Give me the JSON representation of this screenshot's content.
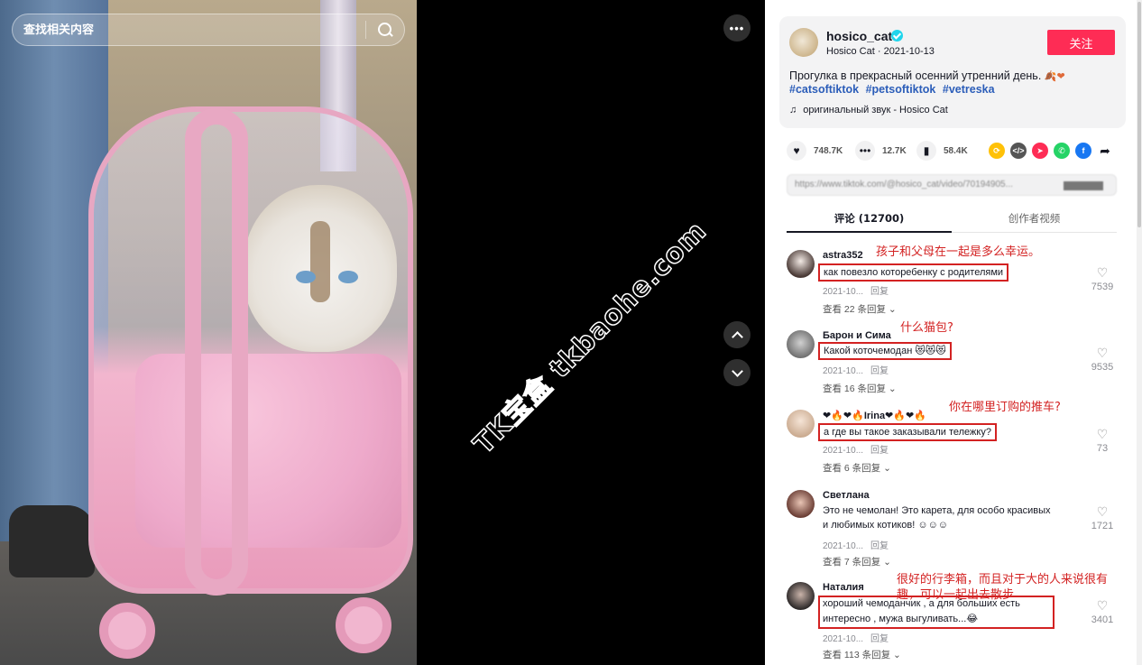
{
  "search": {
    "placeholder": "查找相关内容"
  },
  "video": {
    "more_label": "•••",
    "up_label": "",
    "down_label": "",
    "watermark": "TK宝盒 tkbaohe.com"
  },
  "post": {
    "username": "hosico_cat",
    "sub_line": "Hosico Cat · 2021-10-13",
    "follow_label": "关注",
    "caption": "Прогулка в прекрасный осенний утренний день.",
    "caption_emoji": "🍂❤",
    "hashtags": [
      "#catsoftiktok",
      "#petsoftiktok",
      "#vetreska"
    ],
    "music": "оригинальный звук - Hosico Cat"
  },
  "actions": {
    "likes": "748.7K",
    "comments": "12.7K",
    "saves": "58.4K"
  },
  "link": {
    "text": "https://www.tiktok.com/@hosico_cat/video/70194905..."
  },
  "tabs": {
    "comments": "评论 (12700)",
    "creator_videos": "创作者视频"
  },
  "comments": [
    {
      "name": "astra352",
      "text": "как повезло которебенку с родителями",
      "date": "2021-10...",
      "reply": "回复",
      "replies": "查看 22 条回复",
      "likes": "7539",
      "annotation": "孩子和父母在一起是多么幸运。",
      "avatar_color": "#3a3a3a"
    },
    {
      "name": "Барон и Сима",
      "text": "Какой коточемодан 😻😻😻",
      "date": "2021-10...",
      "reply": "回复",
      "replies": "查看 16 条回复",
      "likes": "9535",
      "annotation": "什么猫包?",
      "avatar_color": "#8c8c8c"
    },
    {
      "name": "❤🔥❤🔥Irina❤🔥❤🔥",
      "text": "а где вы такое заказывали тележку?",
      "date": "2021-10...",
      "reply": "回复",
      "replies": "查看 6 条回复",
      "likes": "73",
      "annotation": "你在哪里订购的推车?",
      "avatar_color": "#d9c3b0"
    },
    {
      "name": "Светлана",
      "text_line1": "Это не чемолан! Это карета, для особо красивых",
      "text_line2": "и любимых котиков! ☺☺☺",
      "date": "2021-10...",
      "reply": "回复",
      "replies": "查看 7 条回复",
      "likes": "1721",
      "avatar_color": "#6b3e35"
    },
    {
      "name": "Наталия",
      "text_line1": "хороший чемоданчик , а для больших есть",
      "text_line2": "интересно , мужа выгуливать...😂",
      "date": "2021-10...",
      "reply": "回复",
      "replies": "查看 113 条回复",
      "likes": "3401",
      "annotation_line1": "很好的行李箱，而且对于大的人来说很有",
      "annotation_line2": "趣，可以一起出去散步",
      "avatar_color": "#2e2a2a"
    }
  ],
  "colors": {
    "accent": "#fe2c55",
    "hashtag": "#2b5db9",
    "annotation": "#d32222",
    "verified": "#20d5ec"
  }
}
